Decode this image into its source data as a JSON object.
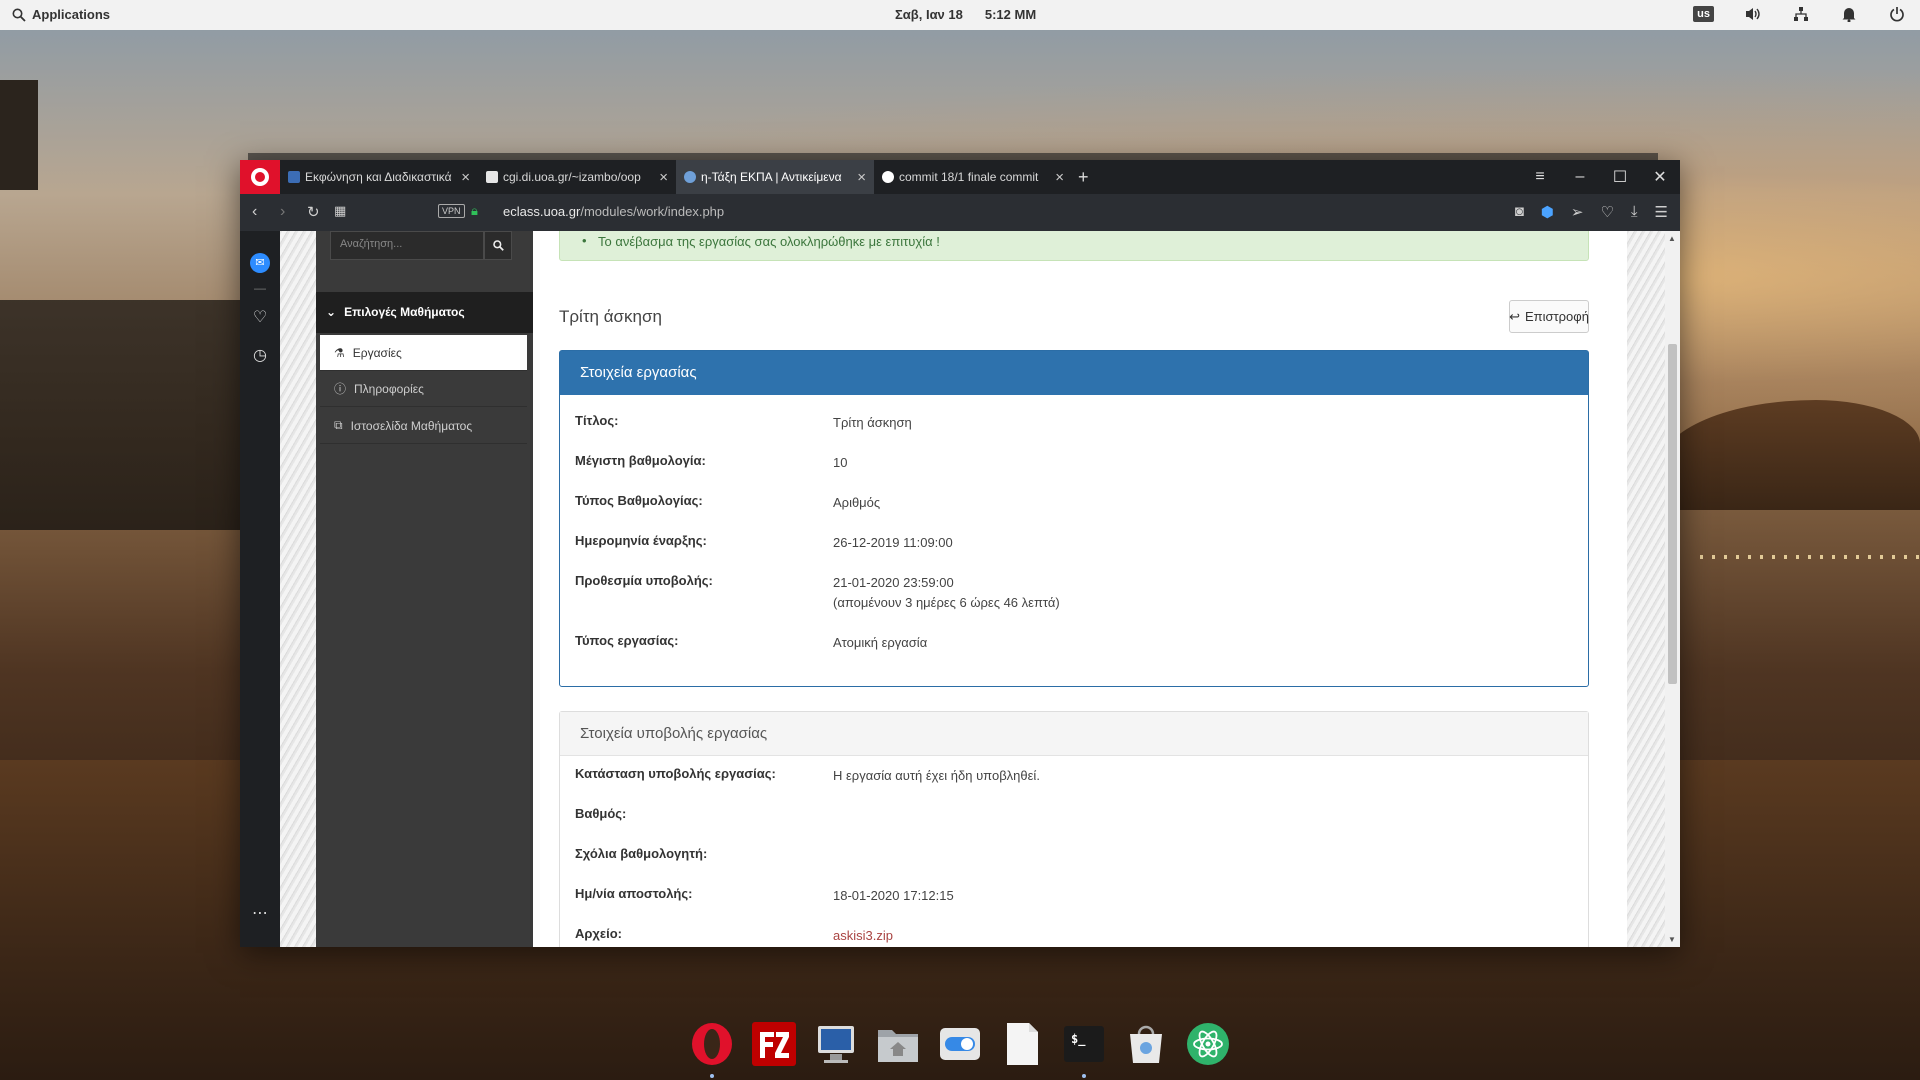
{
  "topbar": {
    "apps_label": "Applications",
    "date": "Σαβ, Ιαν 18",
    "time": "5:12 ΜΜ",
    "keyboard_layout": "us"
  },
  "browser": {
    "tabs": [
      {
        "title": "Εκφώνηση και Διαδικαστικά",
        "icon": "document-icon",
        "active": false
      },
      {
        "title": "cgi.di.uoa.gr/~izambo/oop",
        "icon": "file-icon",
        "active": false
      },
      {
        "title": "η-Τάξη ΕΚΠΑ | Αντικείμενα",
        "icon": "eclass-icon",
        "active": true
      },
      {
        "title": "commit 18/1 finale commit",
        "icon": "github-icon",
        "active": false
      }
    ],
    "vpn_label": "VPN",
    "url_domain": "eclass.uoa.gr",
    "url_path": "/modules/work/index.php"
  },
  "sidebar": {
    "search_placeholder": "Αναζήτηση...",
    "menu_title": "Επιλογές Μαθήματος",
    "items": [
      {
        "label": "Εργασίες",
        "icon": "flask-icon",
        "active": true
      },
      {
        "label": "Πληροφορίες",
        "icon": "info-icon",
        "active": false
      },
      {
        "label": "Ιστοσελίδα Μαθήματος",
        "icon": "external-link-icon",
        "active": false
      }
    ]
  },
  "main": {
    "alert": "Το ανέβασμα της εργασίας σας ολοκληρώθηκε με επιτυχία !",
    "title": "Τρίτη άσκηση",
    "back_label": "Επιστροφή",
    "assignment_panel": {
      "heading": "Στοιχεία εργασίας",
      "rows": [
        {
          "label": "Τίτλος:",
          "value": "Τρίτη άσκηση"
        },
        {
          "label": "Μέγιστη βαθμολογία:",
          "value": "10"
        },
        {
          "label": "Τύπος Βαθμολογίας:",
          "value": "Αριθμός"
        },
        {
          "label": "Ημερομηνία έναρξης:",
          "value": "26-12-2019 11:09:00"
        },
        {
          "label": "Προθεσμία υποβολής:",
          "value": "21-01-2020 23:59:00",
          "value2": "(απομένουν 3 ημέρες 6 ώρες 46 λεπτά)"
        },
        {
          "label": "Τύπος εργασίας:",
          "value": "Ατομική εργασία"
        }
      ]
    },
    "submission_panel": {
      "heading": "Στοιχεία υποβολής εργασίας",
      "rows": [
        {
          "label": "Κατάσταση υποβολής εργασίας:",
          "value": "Η εργασία αυτή έχει ήδη υποβληθεί."
        },
        {
          "label": "Βαθμός:",
          "value": ""
        },
        {
          "label": "Σχόλια βαθμολογητή:",
          "value": ""
        },
        {
          "label": "Ημ/νία αποστολής:",
          "value": "18-01-2020 17:12:15"
        },
        {
          "label": "Αρχείο:",
          "value": "askisi3.zip"
        }
      ]
    }
  },
  "dock": {
    "apps": [
      "opera-icon",
      "filezilla-icon",
      "monitor-icon",
      "home-folder-icon",
      "toggle-settings-icon",
      "text-file-icon",
      "terminal-icon",
      "appcenter-icon",
      "atom-icon"
    ],
    "terminal_glyph": "$_"
  },
  "colors": {
    "opera_red": "#e0112b",
    "panel_blue": "#2e72ad",
    "alert_green_bg": "#dff0d8",
    "alert_green_text": "#3c763d",
    "link_red": "#a94442"
  }
}
